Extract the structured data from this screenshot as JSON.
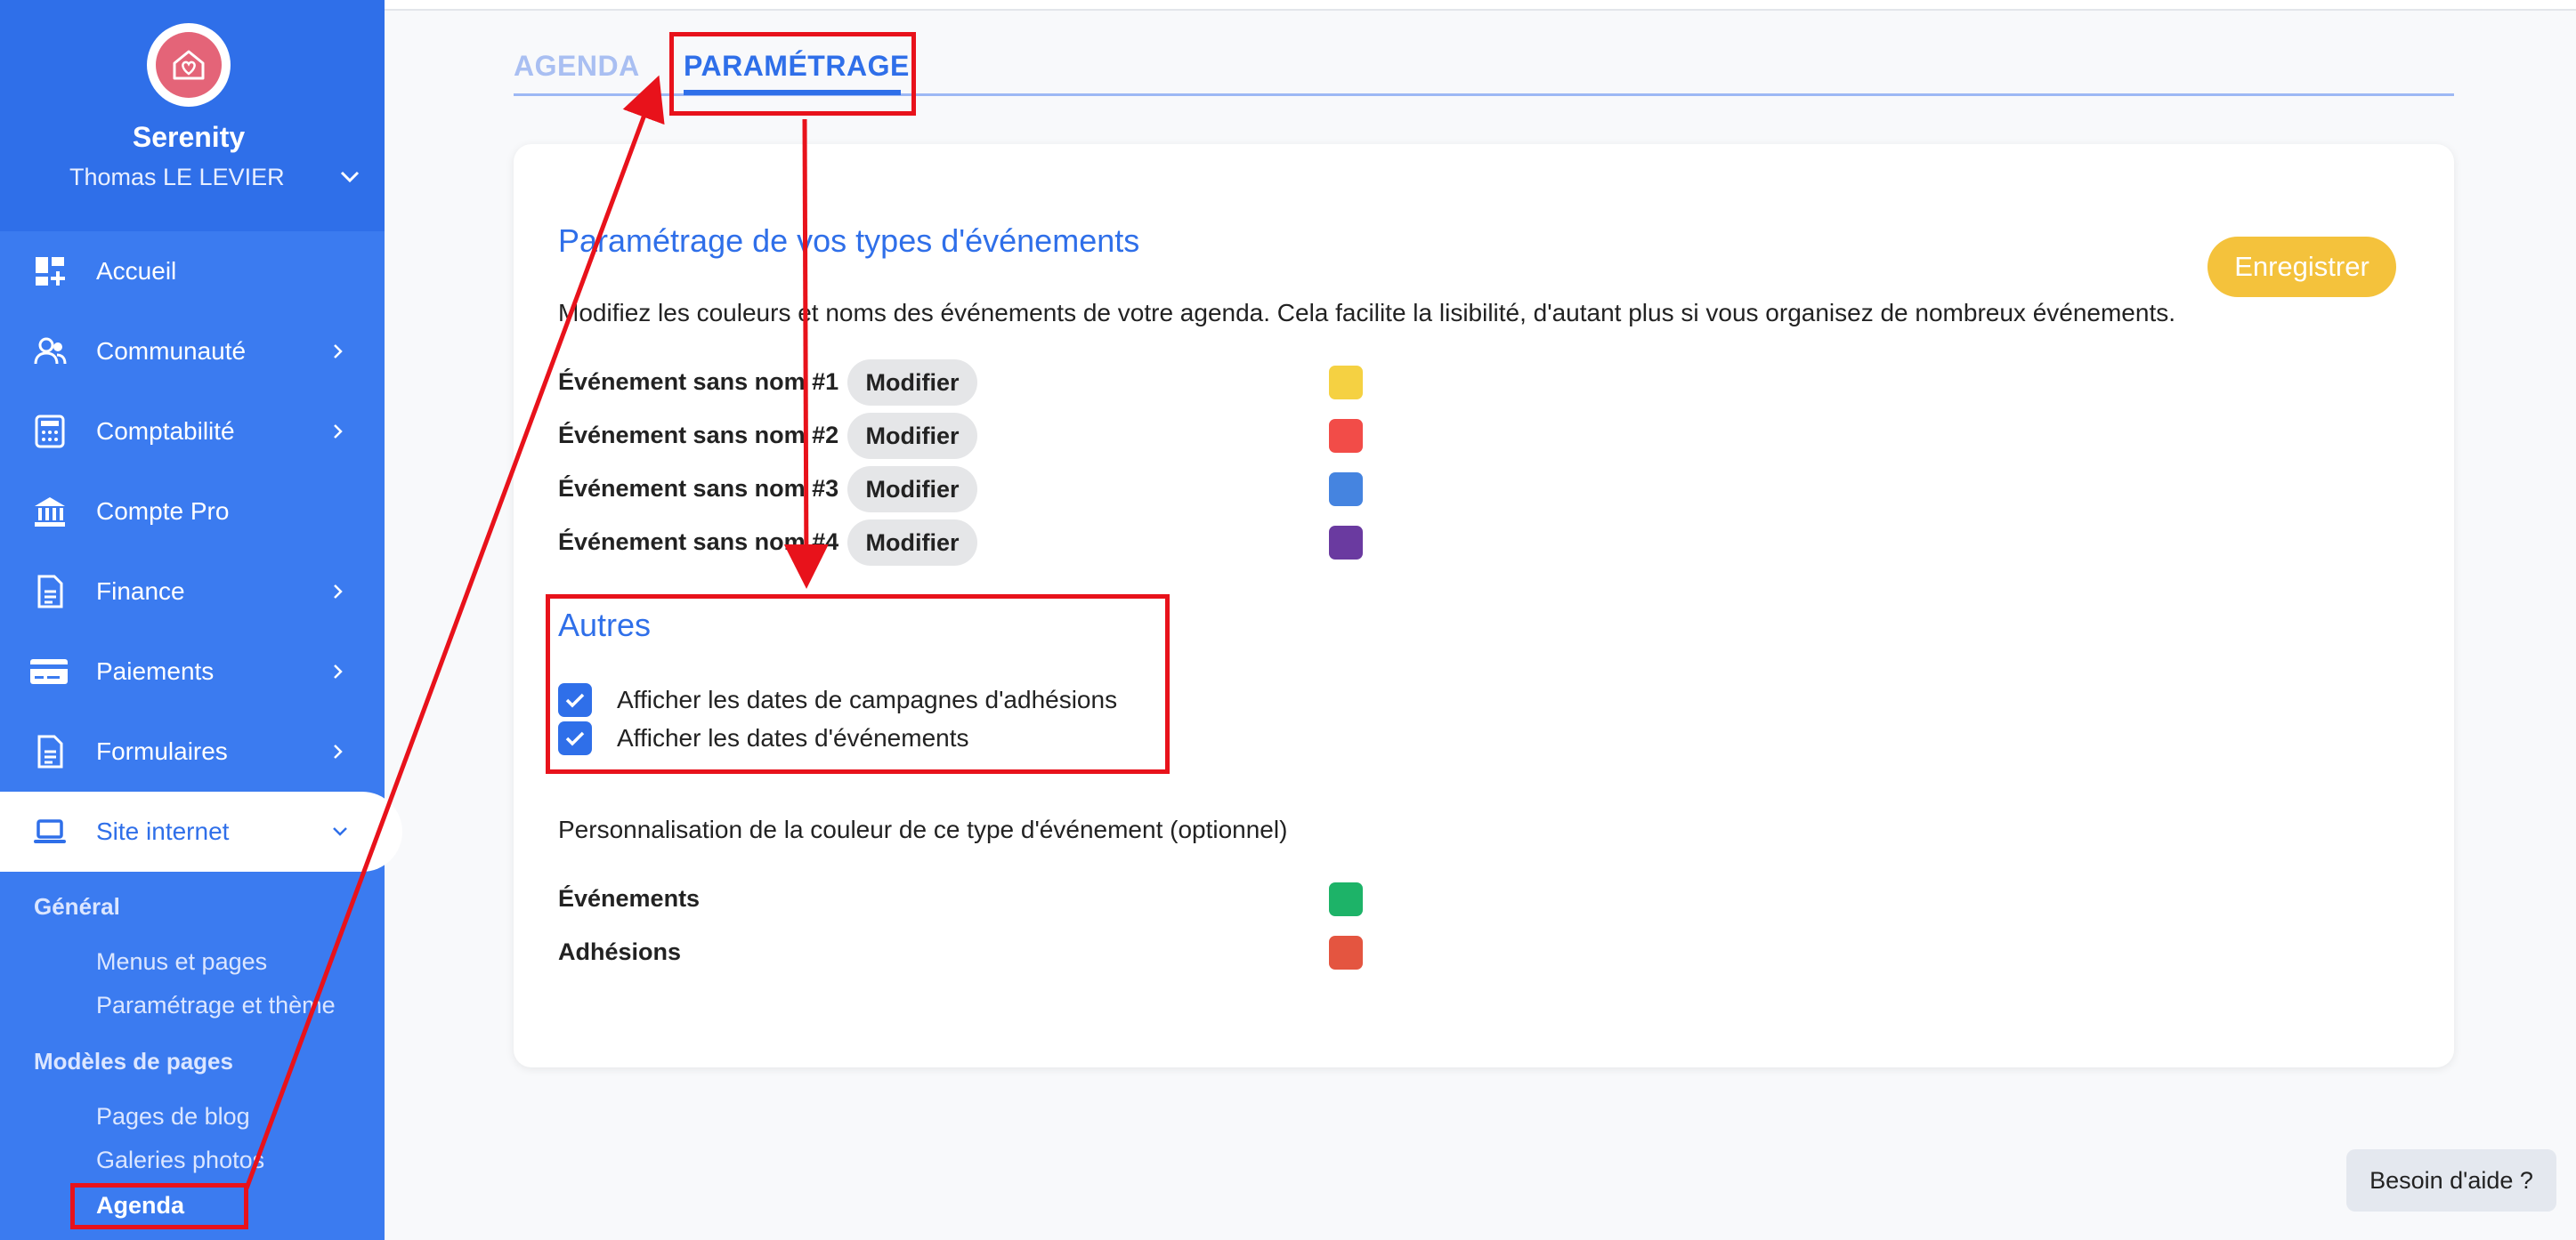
{
  "sidebar": {
    "org_name": "Serenity",
    "user_name": "Thomas LE LEVIER",
    "items": [
      {
        "label": "Accueil",
        "icon": "dashboard-icon",
        "has_chevron": false
      },
      {
        "label": "Communauté",
        "icon": "users-icon",
        "has_chevron": true
      },
      {
        "label": "Comptabilité",
        "icon": "calculator-icon",
        "has_chevron": true
      },
      {
        "label": "Compte Pro",
        "icon": "bank-icon",
        "has_chevron": false
      },
      {
        "label": "Finance",
        "icon": "document-icon",
        "has_chevron": true
      },
      {
        "label": "Paiements",
        "icon": "credit-card-icon",
        "has_chevron": true
      },
      {
        "label": "Formulaires",
        "icon": "document-icon",
        "has_chevron": true
      },
      {
        "label": "Site internet",
        "icon": "laptop-icon",
        "has_chevron": true,
        "active": true
      }
    ],
    "sub_groups": [
      {
        "label": "Général",
        "items": [
          "Menus et pages",
          "Paramétrage et thème"
        ]
      },
      {
        "label": "Modèles de pages",
        "items": [
          "Pages de blog",
          "Galeries photos",
          "Agenda"
        ]
      }
    ],
    "current_sub_item": "Agenda"
  },
  "tabs": [
    {
      "label": "AGENDA",
      "active": false
    },
    {
      "label": "PARAMÉTRAGE",
      "active": true
    }
  ],
  "event_types": {
    "title": "Paramétrage de vos types d'événements",
    "description": "Modifiez les couleurs et noms des événements de votre agenda. Cela facilite la lisibilité, d'autant plus si vous organisez de nombreux événements.",
    "save_label": "Enregistrer",
    "modify_label": "Modifier",
    "rows": [
      {
        "label": "Événement sans nom #1",
        "color": "#f5d142"
      },
      {
        "label": "Événement sans nom #2",
        "color": "#f24c48"
      },
      {
        "label": "Événement sans nom #3",
        "color": "#4584e0"
      },
      {
        "label": "Événement sans nom #4",
        "color": "#6a3aa0"
      }
    ]
  },
  "autres": {
    "title": "Autres",
    "options": [
      {
        "label": "Afficher les dates de campagnes d'adhésions",
        "checked": true
      },
      {
        "label": "Afficher les dates d'événements",
        "checked": true
      }
    ]
  },
  "custom_colors": {
    "intro": "Personnalisation de la couleur de ce type d'événement (optionnel)",
    "rows": [
      {
        "label": "Événements",
        "color": "#1db368"
      },
      {
        "label": "Adhésions",
        "color": "#e45540"
      }
    ]
  },
  "help_label": "Besoin d'aide ?",
  "colors": {
    "brand_blue": "#2f6fe9",
    "sidebar_blue": "#3b7bf0",
    "save_yellow": "#f4c23c",
    "annotation_red": "#e8121b"
  }
}
